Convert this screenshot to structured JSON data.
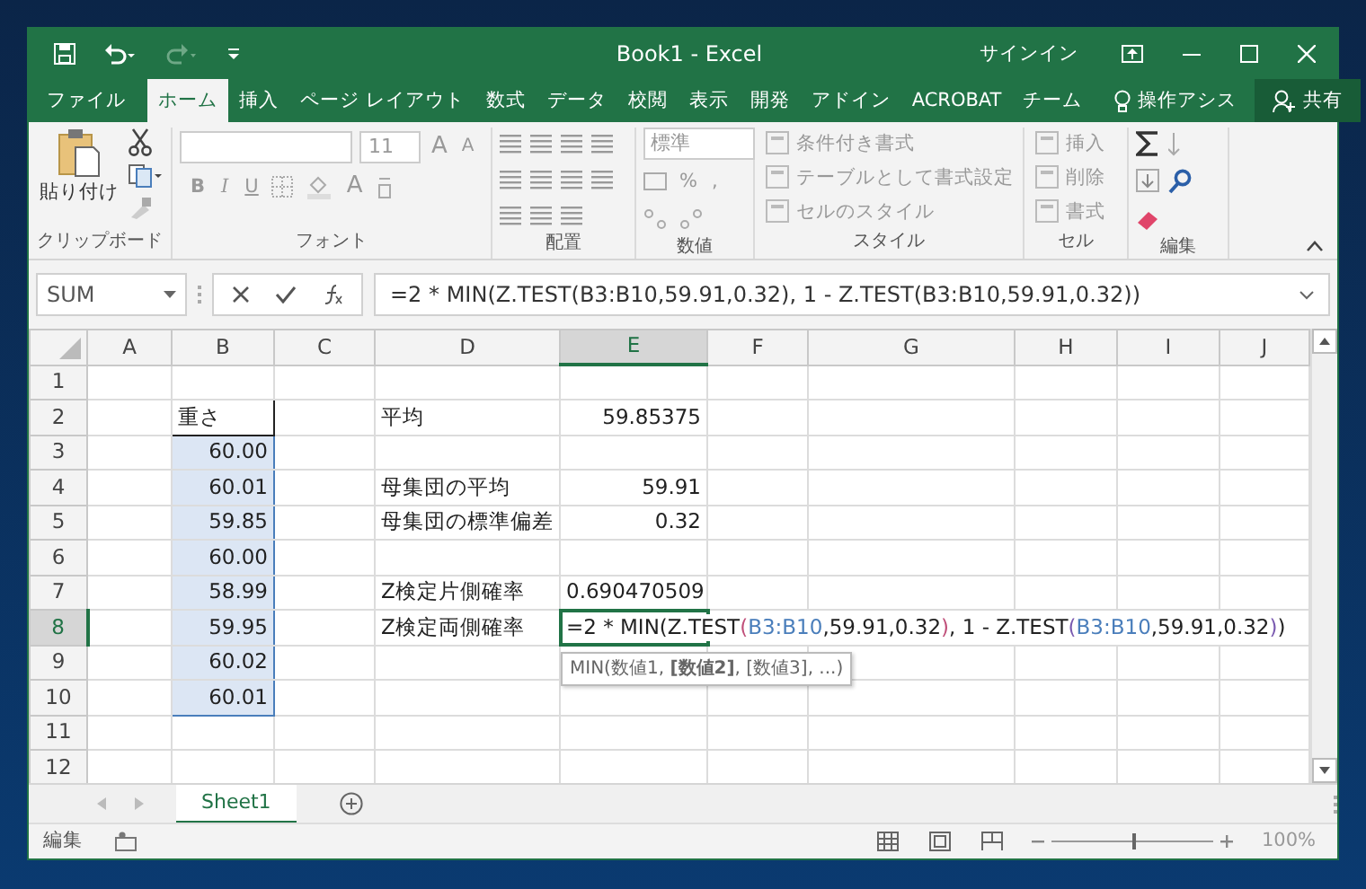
{
  "window": {
    "title": "Book1 - Excel",
    "sign_in": "サインイン"
  },
  "ribbon_tabs": [
    {
      "label": "ファイル",
      "selected": false
    },
    {
      "label": "ホーム",
      "selected": true
    },
    {
      "label": "挿入",
      "selected": false
    },
    {
      "label": "ページ レイアウト",
      "selected": false
    },
    {
      "label": "数式",
      "selected": false
    },
    {
      "label": "データ",
      "selected": false
    },
    {
      "label": "校閲",
      "selected": false
    },
    {
      "label": "表示",
      "selected": false
    },
    {
      "label": "開発",
      "selected": false
    },
    {
      "label": "アドイン",
      "selected": false
    },
    {
      "label": "ACROBAT",
      "selected": false
    },
    {
      "label": "チーム",
      "selected": false
    }
  ],
  "tell_me": "操作アシス",
  "share": "共有",
  "ribbon": {
    "clipboard": {
      "paste": "貼り付け",
      "label": "クリップボード"
    },
    "font": {
      "size": "11",
      "grow": "A",
      "shrink": "A",
      "bold": "B",
      "italic": "I",
      "underline": "U",
      "font_color": "A",
      "label": "フォント"
    },
    "alignment": {
      "label": "配置"
    },
    "number": {
      "format": "標準",
      "percent": "%",
      "comma": ",",
      "label": "数値"
    },
    "styles": {
      "commands": [
        "条件付き書式",
        "テーブルとして書式設定",
        "セルのスタイル"
      ],
      "label": "スタイル"
    },
    "cells": {
      "commands": [
        "挿入",
        "削除",
        "書式"
      ],
      "label": "セル"
    },
    "editing": {
      "label": "編集"
    }
  },
  "formula_bar": {
    "name_box": "SUM",
    "formula": "=2 * MIN(Z.TEST(B3:B10,59.91,0.32), 1 - Z.TEST(B3:B10,59.91,0.32))"
  },
  "columns": [
    {
      "label": "A",
      "selected": false
    },
    {
      "label": "B",
      "selected": false
    },
    {
      "label": "C",
      "selected": false
    },
    {
      "label": "D",
      "selected": false
    },
    {
      "label": "E",
      "selected": true
    },
    {
      "label": "F",
      "selected": false
    },
    {
      "label": "G",
      "selected": false
    },
    {
      "label": "H",
      "selected": false
    },
    {
      "label": "I",
      "selected": false
    },
    {
      "label": "J",
      "selected": false
    }
  ],
  "rows": [
    {
      "header": "1",
      "selected": false
    },
    {
      "header": "2",
      "selected": false,
      "cells": {
        "B": {
          "kind": "text",
          "text": "重さ",
          "bordered": true
        },
        "D": {
          "kind": "text",
          "text": "平均"
        },
        "E": {
          "kind": "number",
          "text": "59.85375"
        }
      }
    },
    {
      "header": "3",
      "selected": false,
      "cells": {
        "B": {
          "kind": "number",
          "text": "60.00",
          "referenced": true
        }
      }
    },
    {
      "header": "4",
      "selected": false,
      "cells": {
        "B": {
          "kind": "number",
          "text": "60.01",
          "referenced": true
        },
        "D": {
          "kind": "text",
          "text": "母集団の平均"
        },
        "E": {
          "kind": "number",
          "text": "59.91"
        }
      }
    },
    {
      "header": "5",
      "selected": false,
      "cells": {
        "B": {
          "kind": "number",
          "text": "59.85",
          "referenced": true
        },
        "D": {
          "kind": "text",
          "text": "母集団の標準偏差"
        },
        "E": {
          "kind": "number",
          "text": "0.32"
        }
      }
    },
    {
      "header": "6",
      "selected": false,
      "cells": {
        "B": {
          "kind": "number",
          "text": "60.00",
          "referenced": true
        }
      }
    },
    {
      "header": "7",
      "selected": false,
      "cells": {
        "B": {
          "kind": "number",
          "text": "58.99",
          "referenced": true
        },
        "D": {
          "kind": "text",
          "text": "Z検定片側確率"
        },
        "E": {
          "kind": "number",
          "text": "0.690470509"
        }
      }
    },
    {
      "header": "8",
      "selected": true,
      "cells": {
        "B": {
          "kind": "number",
          "text": "59.95",
          "referenced": true
        },
        "D": {
          "kind": "text",
          "text": "Z検定両側確率"
        },
        "E": {
          "kind": "formula",
          "editing": true,
          "segments": [
            {
              "kind": "plain",
              "text": "=2 * MIN(Z.TEST"
            },
            {
              "kind": "paren",
              "text": "("
            },
            {
              "kind": "reference",
              "text": "B3:B10"
            },
            {
              "kind": "plain",
              "text": ",59.91,0.32"
            },
            {
              "kind": "paren",
              "text": ")"
            },
            {
              "kind": "plain",
              "text": ", 1 - Z.TEST"
            },
            {
              "kind": "paren2",
              "text": "("
            },
            {
              "kind": "reference",
              "text": "B3:B10"
            },
            {
              "kind": "plain",
              "text": ",59.91,0.32"
            },
            {
              "kind": "paren2",
              "text": ")"
            },
            {
              "kind": "plain",
              "text": ")"
            }
          ],
          "tooltip": "MIN(数値1, **[数値2]**, [数値3], ...)"
        }
      }
    },
    {
      "header": "9",
      "selected": false,
      "cells": {
        "B": {
          "kind": "number",
          "text": "60.02",
          "referenced": true
        }
      }
    },
    {
      "header": "10",
      "selected": false,
      "cells": {
        "B": {
          "kind": "number",
          "text": "60.01",
          "referenced": true
        }
      }
    },
    {
      "header": "11",
      "selected": false
    },
    {
      "header": "12",
      "selected": false
    }
  ],
  "sheet_tabs": [
    {
      "label": "Sheet1",
      "selected": true
    }
  ],
  "status_bar": {
    "mode": "編集",
    "zoom": "100%",
    "zoom_level": {
      "level": 0.5
    }
  }
}
